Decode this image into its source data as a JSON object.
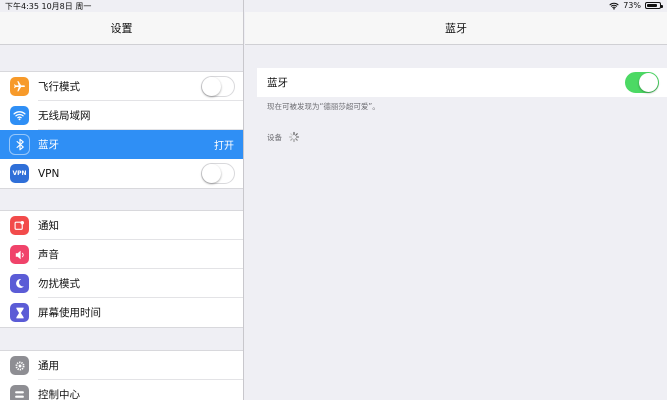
{
  "status": {
    "time_date": "下午4:35  10月8日 周一",
    "battery_percent": "73%"
  },
  "master": {
    "title": "设置",
    "groups": [
      [
        {
          "label": "飞行模式",
          "icon": "airplane-icon",
          "color": "#f79a2a",
          "toggle": false
        },
        {
          "label": "无线局域网",
          "icon": "wifi-icon",
          "color": "#2f8ff5"
        },
        {
          "label": "蓝牙",
          "icon": "bluetooth-icon",
          "color": "#2f8ff5",
          "value": "打开",
          "selected": true
        },
        {
          "label": "VPN",
          "icon": "vpn-icon",
          "color": "#2f6fd8",
          "toggle": false
        }
      ],
      [
        {
          "label": "通知",
          "icon": "notification-icon",
          "color": "#f24b4b"
        },
        {
          "label": "声音",
          "icon": "sound-icon",
          "color": "#f0436a"
        },
        {
          "label": "勿扰模式",
          "icon": "moon-icon",
          "color": "#5b5cd6"
        },
        {
          "label": "屏幕使用时间",
          "icon": "hourglass-icon",
          "color": "#5b5cd6"
        }
      ],
      [
        {
          "label": "通用",
          "icon": "gear-icon",
          "color": "#8e8e93"
        },
        {
          "label": "控制中心",
          "icon": "control-center-icon",
          "color": "#8e8e93"
        }
      ]
    ],
    "icon_text": {
      "vpn": "VPN"
    }
  },
  "detail": {
    "title": "蓝牙",
    "bluetooth_label": "蓝牙",
    "bluetooth_on": true,
    "discoverable_note": "现在可被发现为“德丽莎超可爱”。",
    "devices_label": "设备"
  },
  "colors": {
    "accent": "#2f8ff5",
    "toggle_on": "#4cd964",
    "background": "#efeff4"
  }
}
